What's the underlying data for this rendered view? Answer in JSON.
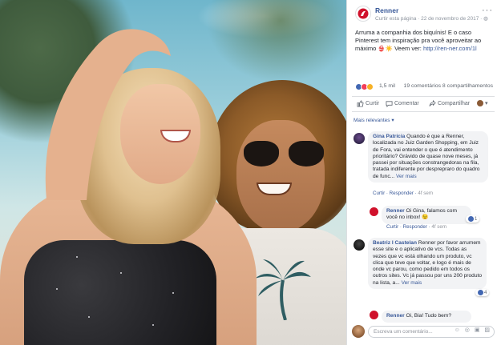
{
  "post": {
    "page_name": "Renner",
    "meta": "Curtir esta página · 22 de novembro de 2017 · ",
    "text_main": "Arruma a companhia dos biquínis! E o caso Pinterest tem inspiração pra você aproveitar ao máximo 👙☀️ Veem ver: ",
    "link": "http://ren-ner.com/1l",
    "more_icon": "ellipsis-icon"
  },
  "reactions": {
    "count": "1,5 mil",
    "stats": "19 comentários  8 compartilhamentos",
    "colors": [
      "#4267b2",
      "#f33e58",
      "#f7b125"
    ]
  },
  "actions": {
    "like": "Curtir",
    "comment": "Comentar",
    "share": "Compartilhar"
  },
  "filter_label": "Mais relevantes ▾",
  "comments": [
    {
      "author": "Gina Patrícia",
      "text": " Quando é que a Renner, localizada no Juiz Garden Shopping, em Juiz de Fora, vai entender o que é atendimento prioritário? Grávido de quase nove meses, já passei por situações constrangedoras na fila, tratada indiferente por desprepraro do quadro de func...",
      "more": "Ver mais",
      "actions": "Curtir · Responder · ",
      "time": "4f sem"
    },
    {
      "author": "Renner",
      "text": " Oi Gina, falamos com você no inbox! 😉",
      "actions": "Curtir · Responder · ",
      "time": "4f sem",
      "likes": "1"
    },
    {
      "author": "Beatriz I Castelan",
      "text": " Renner por favor arrumem esse site e o aplicativo de vcs. Todas as vezes que vc está olhando um produto, vc clica que teve que voltar, e logo é mais de onde vc parou, como pedido em todos os outros sites. Vc já passou por uns 200 produto na lista, a...",
      "more": "Ver mais",
      "actions": "Curtir · Responder · ",
      "time": "4f sem",
      "likes": "4"
    },
    {
      "author": "Renner",
      "text": " Oi, Bia! Tudo bem?"
    }
  ],
  "write_comment": {
    "placeholder": "Escreva um comentário...",
    "tools": "☺ ◎ ▣ ▨"
  }
}
